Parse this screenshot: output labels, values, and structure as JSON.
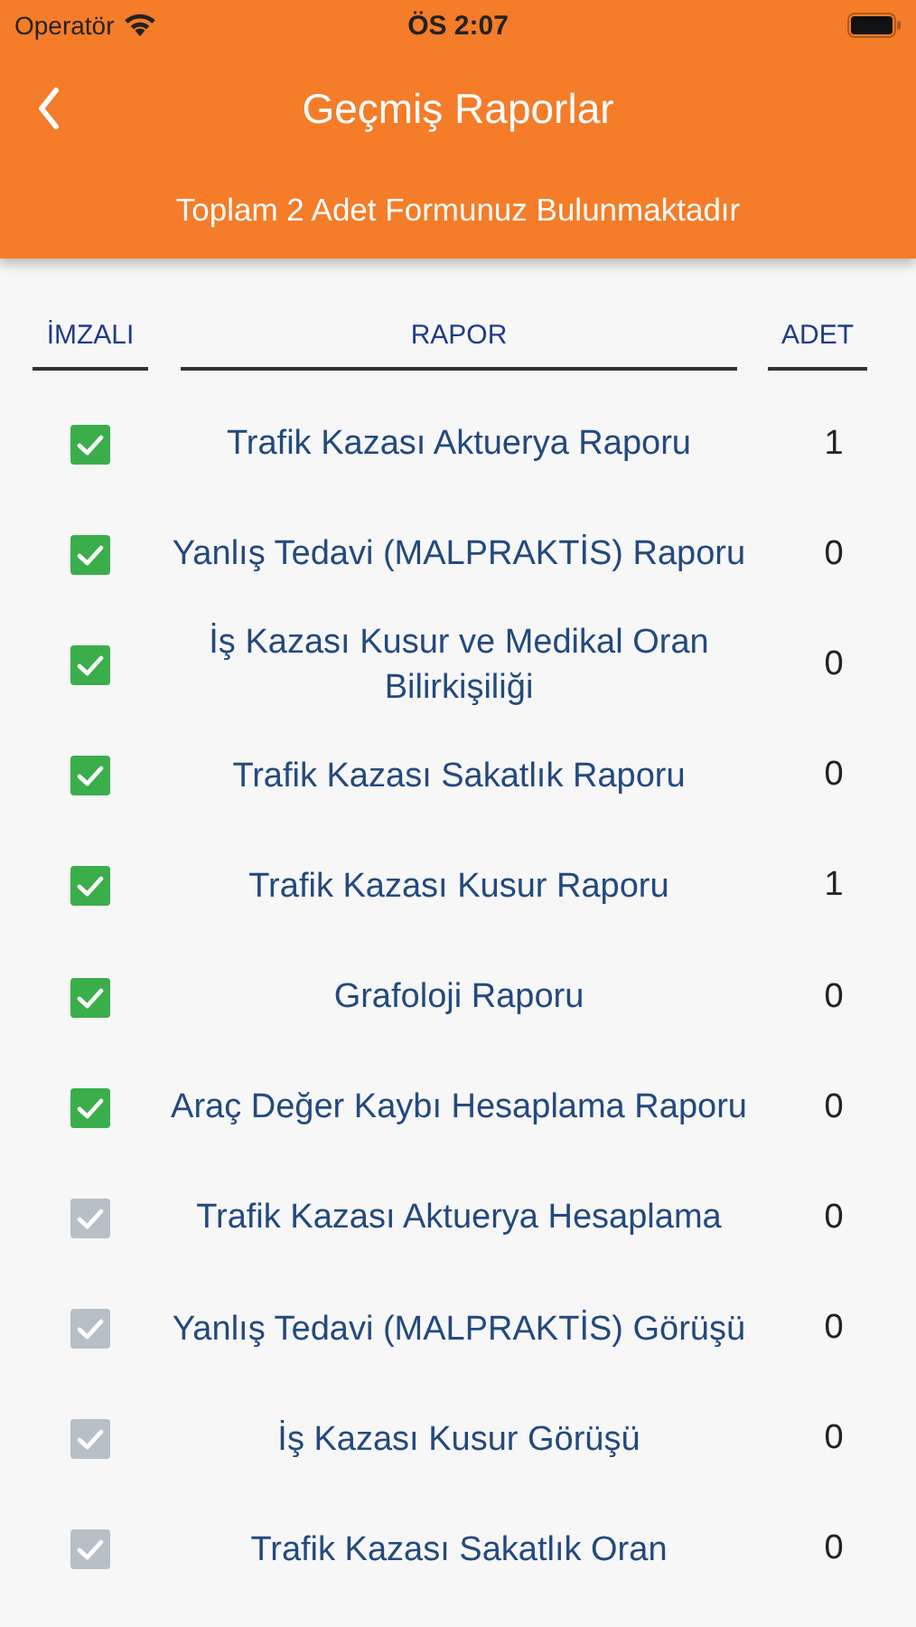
{
  "status_bar": {
    "carrier": "Operatör",
    "time": "ÖS 2:07"
  },
  "nav": {
    "title": "Geçmiş Raporlar",
    "subtitle": "Toplam 2 Adet Formunuz Bulunmaktadır"
  },
  "table": {
    "columns": [
      "İMZALI",
      "RAPOR",
      "ADET"
    ],
    "rows": [
      {
        "signed": true,
        "report": "Trafik Kazası Aktuerya Raporu",
        "count": "1"
      },
      {
        "signed": true,
        "report": "Yanlış Tedavi (MALPRAKTİS) Raporu",
        "count": "0"
      },
      {
        "signed": true,
        "report": "İş Kazası Kusur ve Medikal Oran Bilirkişiliği",
        "count": "0"
      },
      {
        "signed": true,
        "report": "Trafik Kazası Sakatlık Raporu",
        "count": "0"
      },
      {
        "signed": true,
        "report": "Trafik Kazası Kusur Raporu",
        "count": "1"
      },
      {
        "signed": true,
        "report": "Grafoloji Raporu",
        "count": "0"
      },
      {
        "signed": true,
        "report": "Araç Değer Kaybı Hesaplama Raporu",
        "count": "0"
      },
      {
        "signed": false,
        "report": "Trafik Kazası Aktuerya Hesaplama",
        "count": "0"
      },
      {
        "signed": false,
        "report": "Yanlış Tedavi (MALPRAKTİS) Görüşü",
        "count": "0"
      },
      {
        "signed": false,
        "report": "İş Kazası Kusur Görüşü",
        "count": "0"
      },
      {
        "signed": false,
        "report": "Trafik Kazası Sakatlık Oran",
        "count": "0"
      }
    ]
  }
}
